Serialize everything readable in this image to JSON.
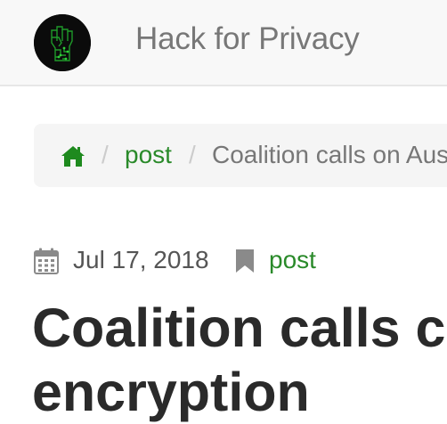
{
  "navbar": {
    "brand": "Hack for Privacy",
    "logo_icon": "raised-fist-circuit-logo"
  },
  "breadcrumb": {
    "home_icon": "home-icon",
    "separator": "/",
    "items": [
      {
        "label": "post"
      },
      {
        "label": "Coalition calls on Aust"
      }
    ]
  },
  "post": {
    "date_icon": "calendar-icon",
    "date": "Jul 17, 2018",
    "category_icon": "bookmark-icon",
    "category": "post",
    "title_line1": "Coalition calls c",
    "title_line2": "encryption"
  },
  "colors": {
    "link": "#2a8a2a",
    "muted": "#777777",
    "navbar_bg": "#f8f8f8",
    "breadcrumb_bg": "#f5f5f5"
  }
}
